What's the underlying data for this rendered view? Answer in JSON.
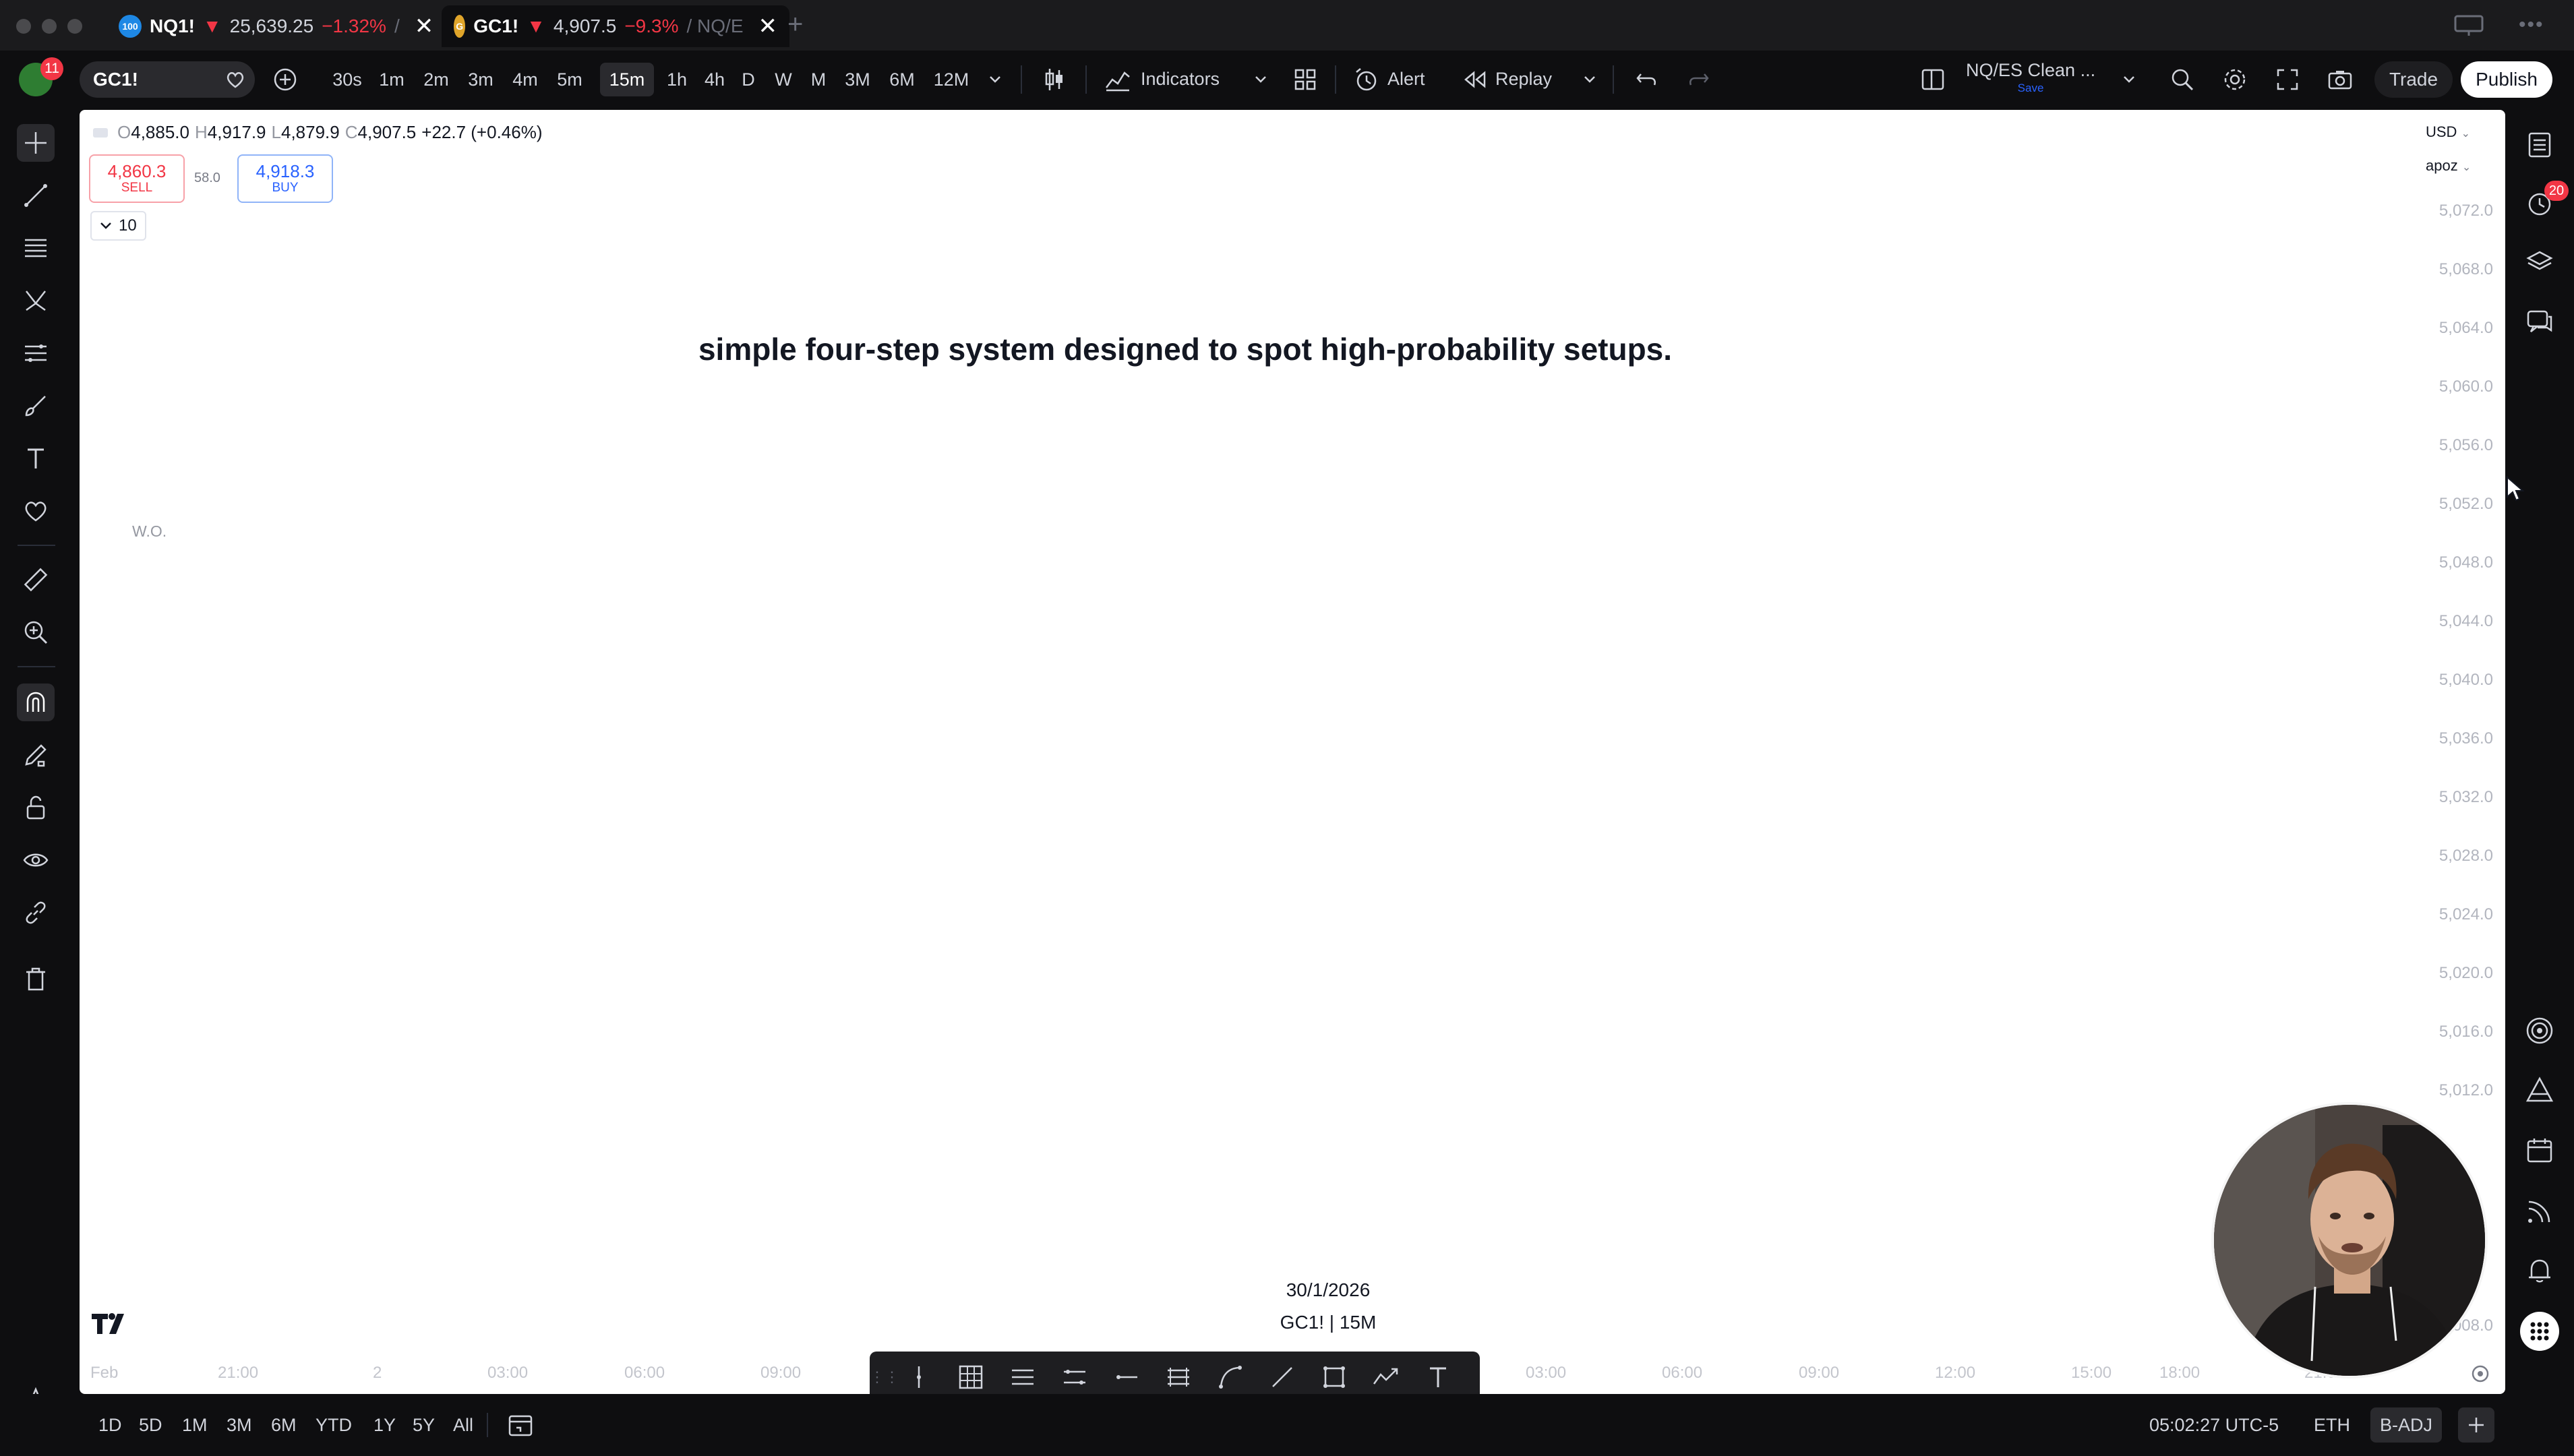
{
  "tabs": [
    {
      "logo": "100",
      "symbol": "NQ1!",
      "arrow": "▼",
      "price": "25,639.25",
      "change": "−1.32%",
      "suffix": "/",
      "close": "✕"
    },
    {
      "logo": "G",
      "symbol": "GC1!",
      "arrow": "▼",
      "price": "4,907.5",
      "change": "−9.3%",
      "suffix": "/ NQ/E",
      "close": "✕"
    }
  ],
  "new_tab": "+",
  "toolbar": {
    "notification_count": "11",
    "symbol": "GC1!",
    "intervals": [
      "30s",
      "1m",
      "2m",
      "3m",
      "4m",
      "5m",
      "15m",
      "1h",
      "4h",
      "D",
      "W",
      "M",
      "3M",
      "6M",
      "12M"
    ],
    "active_interval": "15m",
    "indicators_label": "Indicators",
    "alert_label": "Alert",
    "replay_label": "Replay",
    "layout_name": "NQ/ES Clean ...",
    "layout_status": "Save",
    "trade_label": "Trade",
    "publish_label": "Publish"
  },
  "chart": {
    "ohlc": {
      "o_label": "O",
      "o": "4,885.0",
      "h_label": "H",
      "h": "4,917.9",
      "l_label": "L",
      "l": "4,879.9",
      "c_label": "C",
      "c": "4,907.5",
      "change": "+22.7 (+0.46%)"
    },
    "sell": {
      "price": "4,860.3",
      "label": "SELL"
    },
    "buy": {
      "price": "4,918.3",
      "label": "BUY"
    },
    "spread": "58.0",
    "collapse_count": "10",
    "caption": "simple four-step system designed to spot high-probability setups.",
    "indicator_label": "W.O.",
    "currency": "USD",
    "scale_label": "apoz",
    "price_ticks": [
      "5,072.0",
      "5,068.0",
      "5,064.0",
      "5,060.0",
      "5,056.0",
      "5,052.0",
      "5,048.0",
      "5,044.0",
      "5,040.0",
      "5,036.0",
      "5,032.0",
      "5,028.0",
      "5,024.0",
      "5,020.0",
      "5,016.0",
      "5,012.0",
      "5,008.0"
    ],
    "time_ticks": [
      "Feb",
      "21:00",
      "2",
      "03:00",
      "06:00",
      "09:00",
      "03:00",
      "06:00",
      "09:00",
      "12:00",
      "15:00",
      "18:00",
      "21:00"
    ],
    "crosshair_date": "30/1/2026",
    "symbol_interval": "GC1! | 15M"
  },
  "bottombar": {
    "ranges": [
      "1D",
      "5D",
      "1M",
      "3M",
      "6M",
      "YTD",
      "1Y",
      "5Y",
      "All"
    ],
    "clock": "05:02:27 UTC-5",
    "session": "ETH",
    "adjust": "B-ADJ"
  },
  "rightbar": {
    "alerts_badge": "20"
  },
  "colors": {
    "accent_blue": "#2962ff",
    "sell_red": "#f23645",
    "chart_bg": "#ffffff",
    "ui_bg": "#0e0e10"
  }
}
